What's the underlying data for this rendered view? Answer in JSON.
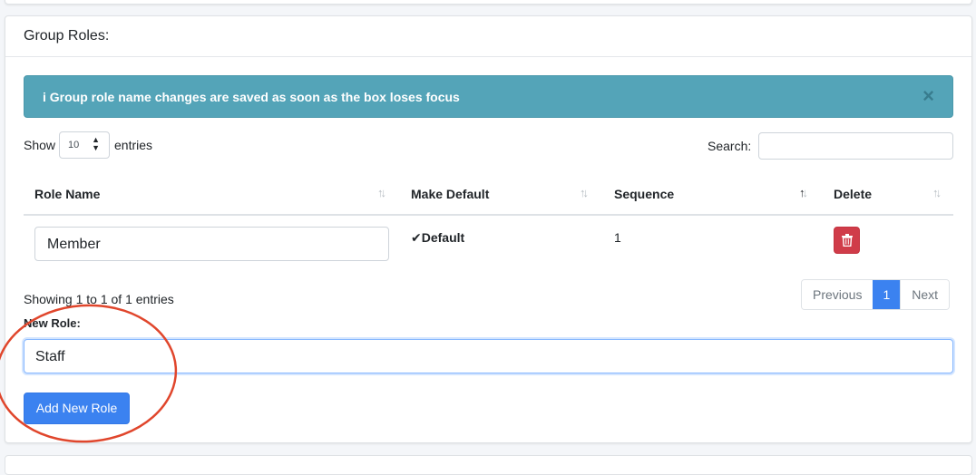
{
  "card": {
    "title": "Group Roles:"
  },
  "alert": {
    "icon": "info-icon",
    "icon_glyph": "i",
    "message": "Group role name changes are saved as soon as the box loses focus",
    "close_glyph": "×"
  },
  "length_menu": {
    "prefix": "Show",
    "value": "10",
    "suffix": "entries"
  },
  "search": {
    "label": "Search:",
    "value": ""
  },
  "table": {
    "columns": [
      {
        "label": "Role Name"
      },
      {
        "label": "Make Default"
      },
      {
        "label": "Sequence"
      },
      {
        "label": "Delete"
      }
    ],
    "rows": [
      {
        "role_name": "Member",
        "default_label": "Default",
        "sequence": "1"
      }
    ]
  },
  "footer": {
    "info": "Showing 1 to 1 of 1 entries",
    "pagination": {
      "previous": "Previous",
      "current": "1",
      "next": "Next"
    }
  },
  "new_role": {
    "label": "New Role:",
    "value": "Staff",
    "button_label": "Add New Role"
  },
  "colors": {
    "alert": "#54a4b8",
    "primary": "#3b82f0",
    "danger": "#d03c49",
    "annotation": "#e0462c"
  }
}
